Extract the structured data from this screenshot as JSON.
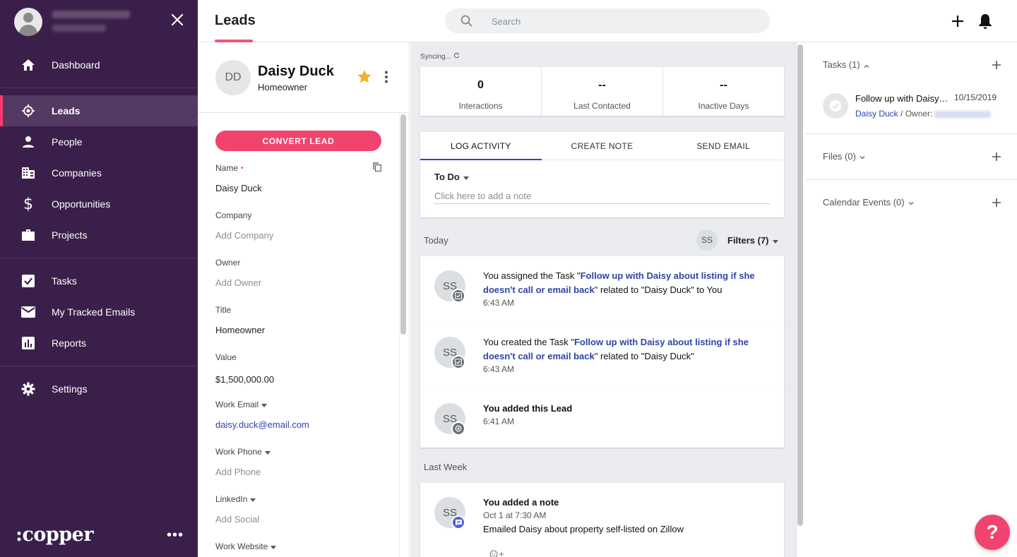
{
  "sidebar": {
    "close_icon": "close-icon",
    "items": [
      {
        "label": "Dashboard",
        "icon": "home-icon"
      },
      {
        "label": "Leads",
        "icon": "target-icon",
        "active": true
      },
      {
        "label": "People",
        "icon": "person-icon"
      },
      {
        "label": "Companies",
        "icon": "building-icon"
      },
      {
        "label": "Opportunities",
        "icon": "dollar-icon"
      },
      {
        "label": "Projects",
        "icon": "briefcase-icon"
      },
      {
        "label": "Tasks",
        "icon": "checkbox-icon"
      },
      {
        "label": "My Tracked Emails",
        "icon": "mail-icon"
      },
      {
        "label": "Reports",
        "icon": "bar-chart-icon"
      },
      {
        "label": "Settings",
        "icon": "gear-icon"
      }
    ],
    "logo": ":copper",
    "more": "•••"
  },
  "header": {
    "title": "Leads",
    "search_placeholder": "Search",
    "accent": "#f1567b"
  },
  "lead": {
    "initials": "DD",
    "name": "Daisy Duck",
    "subtitle": "Homeowner",
    "convert_label": "CONVERT LEAD",
    "fields": [
      {
        "label": "Name",
        "value": "Daisy Duck"
      },
      {
        "label": "Company",
        "value": "Add Company"
      },
      {
        "label": "Owner",
        "value": "Add Owner"
      },
      {
        "label": "Title",
        "value": "Homeowner"
      },
      {
        "label": "Value",
        "value": "$1,500,000.00"
      },
      {
        "label": "Work Email",
        "value": "daisy.duck@email.com"
      },
      {
        "label": "Work Phone",
        "value": "Add Phone"
      },
      {
        "label": "LinkedIn",
        "value": "Add Social"
      },
      {
        "label": "Work Website",
        "value": ""
      }
    ]
  },
  "feed": {
    "syncing": "Syncing...",
    "stats": [
      {
        "value": "0",
        "label": "Interactions"
      },
      {
        "value": "--",
        "label": "Last Contacted"
      },
      {
        "value": "--",
        "label": "Inactive Days"
      }
    ],
    "tabs": [
      "LOG ACTIVITY",
      "CREATE NOTE",
      "SEND EMAIL"
    ],
    "todo_label": "To Do",
    "note_placeholder": "Click here to add a note",
    "group_today": "Today",
    "group_last_week": "Last Week",
    "filter_avatar": "SS",
    "filters_label": "Filters (7)",
    "activities": [
      {
        "initials": "SS",
        "prefix": "You assigned the Task \"",
        "link": "Follow up with Daisy about listing if she doesn't call or email back",
        "suffix": "\" related to \"Daisy Duck\" to You",
        "time": "6:43 AM"
      },
      {
        "initials": "SS",
        "prefix": "You created the Task \"",
        "link": "Follow up with Daisy about listing if she doesn't call or email back",
        "suffix": "\" related to \"Daisy Duck\"",
        "time": "6:43 AM"
      },
      {
        "initials": "SS",
        "title": "You added this Lead",
        "time": "6:41 AM"
      },
      {
        "initials": "SS",
        "title": "You added a note",
        "time": "Oct 1 at 7:30 AM",
        "body": "Emailed Daisy about property self-listed on Zillow"
      }
    ]
  },
  "right": {
    "tasks_title": "Tasks (1)",
    "task": {
      "title": "Follow up with Daisy about listing if she doesn't call or email back",
      "date": "10/15/2019",
      "related": "Daisy Duck",
      "owner_label": " / Owner:"
    },
    "files_title": "Files (0)",
    "events_title": "Calendar Events (0)"
  },
  "help_label": "?"
}
